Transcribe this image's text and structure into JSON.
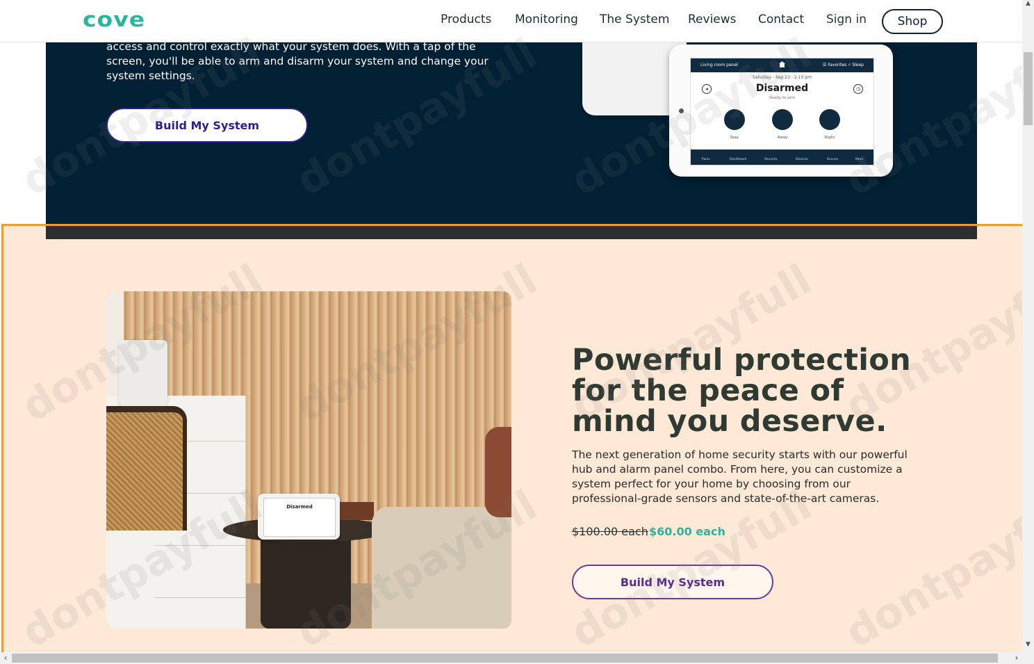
{
  "header": {
    "logo": "cove",
    "nav": [
      "Products",
      "Monitoring",
      "The System",
      "Reviews",
      "Contact"
    ],
    "sign_in": "Sign in",
    "shop": "Shop"
  },
  "dark_section": {
    "text": "access and control exactly what your system does. With a tap of the screen, you'll be able to arm and disarm your system and change your system settings.",
    "button": "Build My System",
    "panel": {
      "top_left": "Living room panel",
      "top_right": "☰ Favorites   ⚡ Sleep",
      "date": "Saturday - Sep 23 - 2:15 pm",
      "status": "Disarmed",
      "sub": "Ready to arm",
      "modes": [
        "Stay",
        "Away",
        "Night"
      ],
      "tabs": [
        "Panic",
        "Dashboard",
        "Security",
        "Devices",
        "Scenes",
        "More"
      ]
    }
  },
  "promo": {
    "headline": "Powerful protection for the peace of mind you deserve.",
    "body": "The next generation of home security starts with our powerful hub and alarm panel combo. From here, you can customize a system perfect for your home by choosing from our professional-grade sensors and state-of-the-art cameras.",
    "price_old": "$100.00 each",
    "price_new": "$60.00 each",
    "button": "Build My System",
    "photo_panel_status": "Disarmed"
  },
  "watermark": "dontpayfull",
  "colors": {
    "brand_teal": "#2bb59a",
    "navy": "#022033",
    "peach": "#fee9d6",
    "highlight_orange": "#f39a30",
    "purple": "#2d2090"
  }
}
